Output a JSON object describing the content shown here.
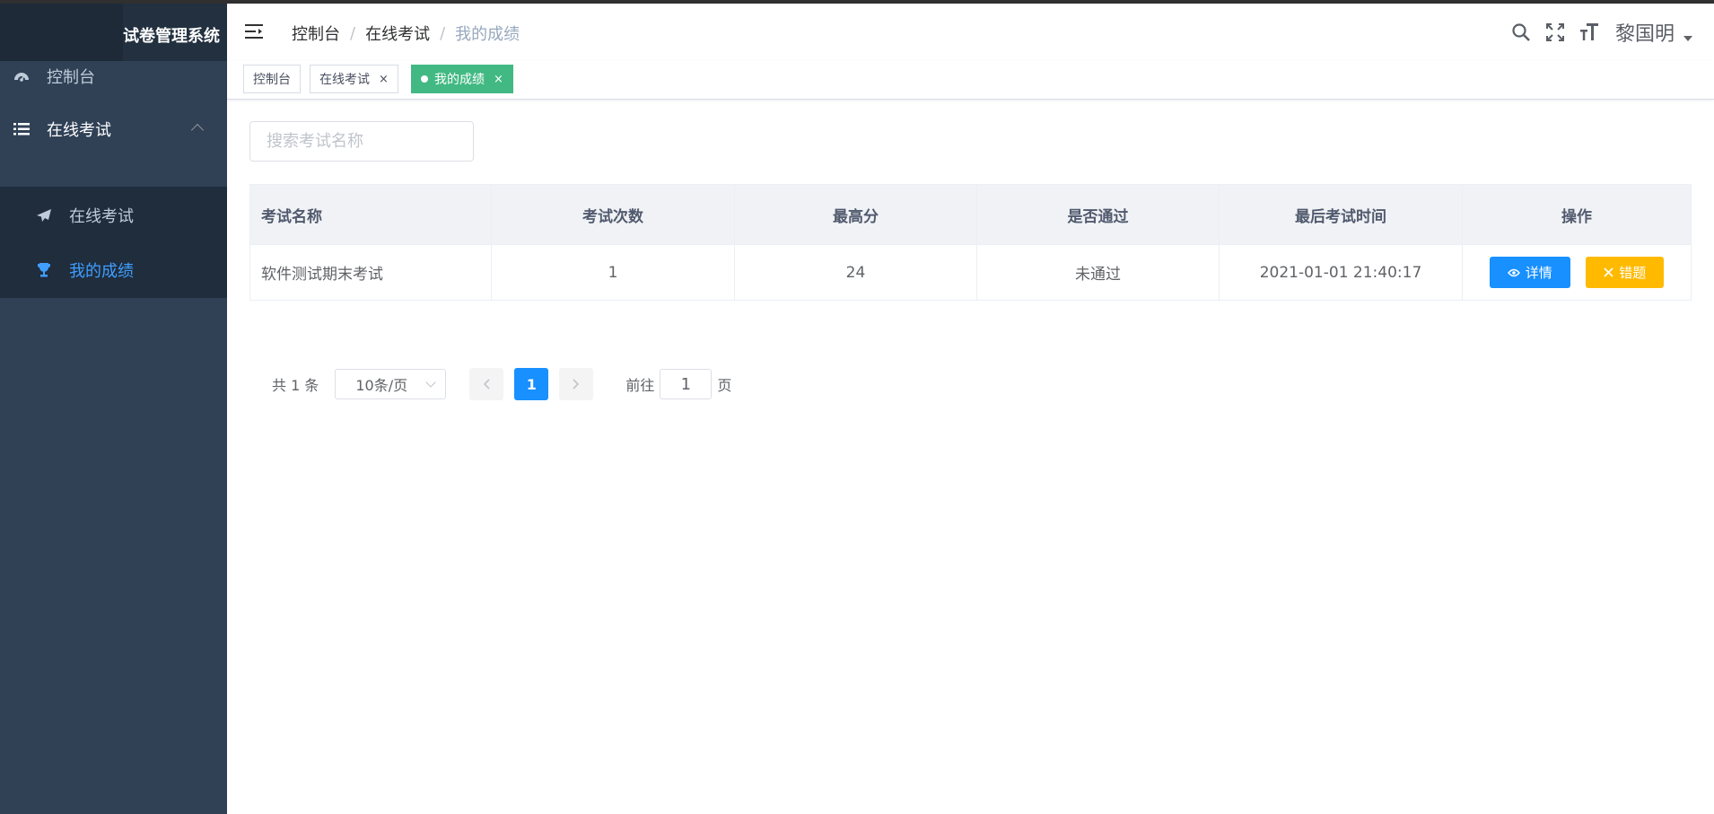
{
  "app": {
    "title": "试卷管理系统",
    "visible_title": "试卷管理系统"
  },
  "sidebar": {
    "items": [
      {
        "label": "控制台",
        "icon": "dashboard-icon"
      },
      {
        "label": "在线考试",
        "icon": "list-icon",
        "expanded": true,
        "children": [
          {
            "label": "在线考试",
            "icon": "paper-plane-icon"
          },
          {
            "label": "我的成绩",
            "icon": "trophy-icon",
            "active": true
          }
        ]
      }
    ]
  },
  "header": {
    "breadcrumb": [
      "控制台",
      "在线考试",
      "我的成绩"
    ],
    "user": "黎国明"
  },
  "tags": [
    {
      "label": "控制台"
    },
    {
      "label": "在线考试",
      "close": "×"
    },
    {
      "label": "我的成绩",
      "close": "×",
      "active": true
    }
  ],
  "search": {
    "placeholder": "搜索考试名称"
  },
  "table": {
    "columns": [
      "考试名称",
      "考试次数",
      "最高分",
      "是否通过",
      "最后考试时间",
      "操作"
    ],
    "rows": [
      {
        "name": "软件测试期末考试",
        "count": "1",
        "max": "24",
        "passed": "未通过",
        "last": "2021-01-01 21:40:17"
      }
    ],
    "actions": {
      "detail": "详情",
      "wrong": "错题"
    }
  },
  "pagination": {
    "total": "共 1 条",
    "page_size": "10条/页",
    "current": "1",
    "goto_label": "前往",
    "goto_value": "1",
    "page_suffix": "页"
  },
  "colors": {
    "sidebar": "#304156",
    "accent": "#1890ff",
    "tag_active": "#42b983",
    "warning": "#ffba00",
    "fail": "#ff0000"
  }
}
